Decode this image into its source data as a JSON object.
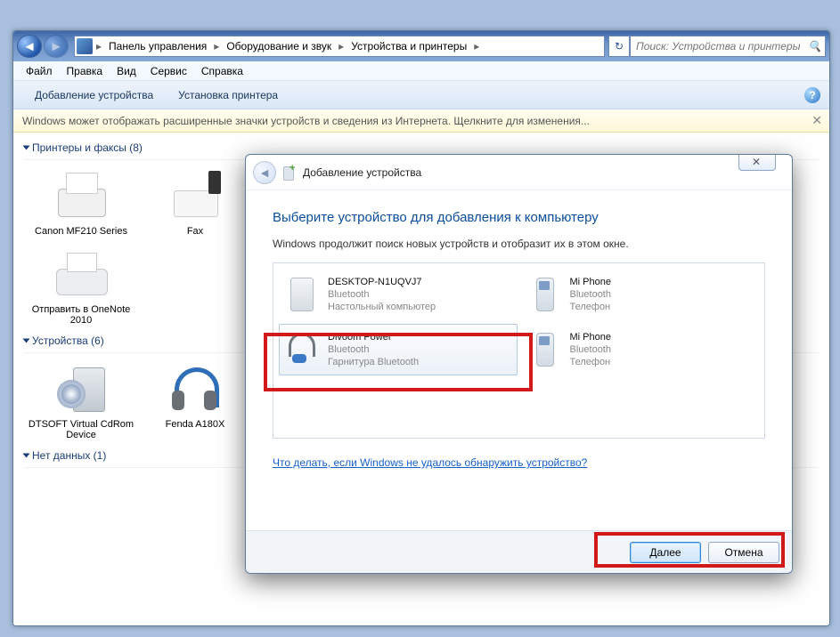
{
  "breadcrumb": {
    "items": [
      "Панель управления",
      "Оборудование и звук",
      "Устройства и принтеры"
    ]
  },
  "search": {
    "placeholder": "Поиск: Устройства и принтеры"
  },
  "menu": {
    "file": "Файл",
    "edit": "Правка",
    "view": "Вид",
    "service": "Сервис",
    "help": "Справка"
  },
  "toolbar": {
    "add_device": "Добавление устройства",
    "add_printer": "Установка принтера"
  },
  "infobar": {
    "text": "Windows может отображать расширенные значки устройств и сведения из Интернета.  Щелкните для изменения..."
  },
  "groups": {
    "printers": {
      "label": "Принтеры и факсы",
      "count": "(8)",
      "items": [
        {
          "name": "Canon MF210 Series",
          "icon": "printer"
        },
        {
          "name": "Fax",
          "icon": "fax"
        },
        {
          "name": "Отправить в OneNote 2010",
          "icon": "printer2"
        }
      ]
    },
    "devices": {
      "label": "Устройства",
      "count": "(6)",
      "items": [
        {
          "name": "DTSOFT Virtual CdRom Device",
          "icon": "cdrom"
        },
        {
          "name": "Fenda A180X",
          "icon": "headset"
        }
      ]
    },
    "nodata": {
      "label": "Нет данных",
      "count": "(1)"
    }
  },
  "dialog": {
    "title": "Добавление устройства",
    "heading": "Выберите устройство для добавления к компьютеру",
    "subtext": "Windows продолжит поиск новых устройств и отобразит их в этом окне.",
    "devices": [
      {
        "name": "DESKTOP-N1UQVJ7",
        "proto": "Bluetooth",
        "type": "Настольный компьютер",
        "icon": "computer",
        "selected": false
      },
      {
        "name": "Mi Phone",
        "proto": "Bluetooth",
        "type": "Телефон",
        "icon": "phone",
        "selected": false
      },
      {
        "name": "Divoom Power",
        "proto": "Bluetooth",
        "type": "Гарнитура Bluetooth",
        "icon": "bt-headset",
        "selected": true
      },
      {
        "name": "Mi Phone",
        "proto": "Bluetooth",
        "type": "Телефон",
        "icon": "phone",
        "selected": false
      }
    ],
    "help_link": "Что делать, если Windows не удалось обнаружить устройство?",
    "btn_next": "Далее",
    "btn_cancel": "Отмена"
  }
}
